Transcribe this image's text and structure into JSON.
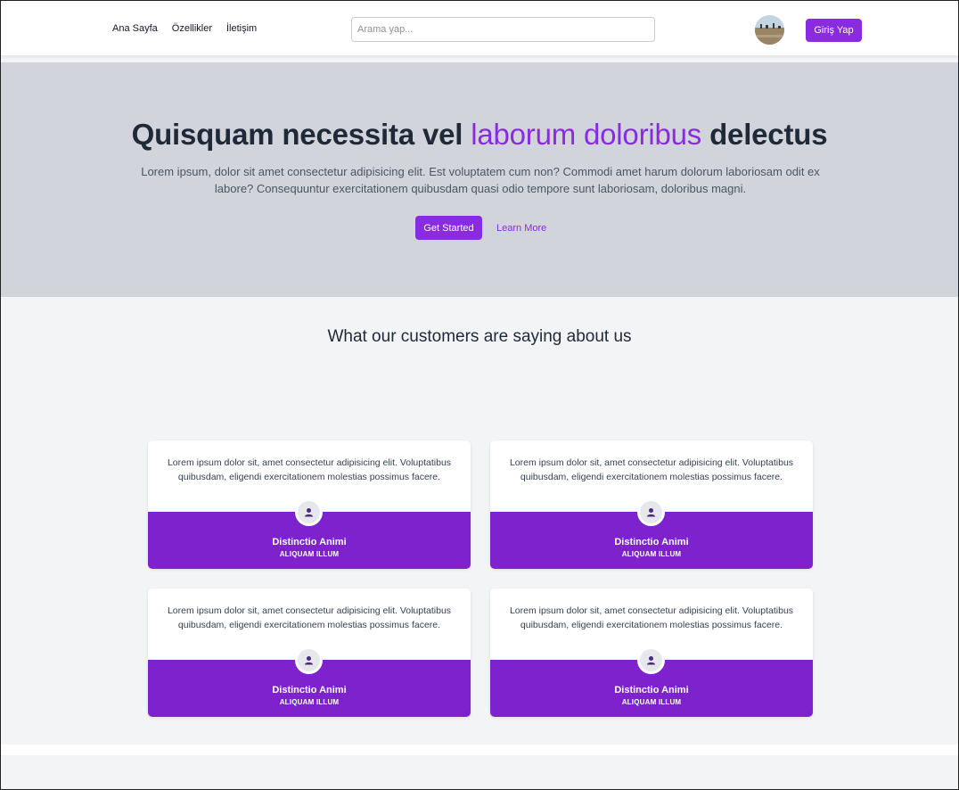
{
  "nav": {
    "links": [
      "Ana Sayfa",
      "Özellikler",
      "İletişim"
    ],
    "search_placeholder": "Arama yap...",
    "login_label": "Giriş Yap"
  },
  "hero": {
    "title_start": "Quisquam necessita vel ",
    "title_accent": "laborum doloribus",
    "title_end": " delectus",
    "subtitle": "Lorem ipsum, dolor sit amet consectetur adipisicing elit. Est voluptatem cum non? Commodi amet harum dolorum laboriosam odit ex labore? Consequuntur exercitationem quibusdam quasi odio tempore sunt laboriosam, doloribus magni.",
    "primary_cta": "Get Started",
    "secondary_cta": "Learn More"
  },
  "testimonials": {
    "title": "What our customers are saying about us",
    "items": [
      {
        "quote": "Lorem ipsum dolor sit, amet consectetur adipisicing elit. Voluptatibus quibusdam, eligendi exercitationem molestias possimus facere.",
        "name": "Distinctio Animi",
        "role": "ALIQUAM ILLUM"
      },
      {
        "quote": "Lorem ipsum dolor sit, amet consectetur adipisicing elit. Voluptatibus quibusdam, eligendi exercitationem molestias possimus facere.",
        "name": "Distinctio Animi",
        "role": "ALIQUAM ILLUM"
      },
      {
        "quote": "Lorem ipsum dolor sit, amet consectetur adipisicing elit. Voluptatibus quibusdam, eligendi exercitationem molestias possimus facere.",
        "name": "Distinctio Animi",
        "role": "ALIQUAM ILLUM"
      },
      {
        "quote": "Lorem ipsum dolor sit, amet consectetur adipisicing elit. Voluptatibus quibusdam, eligendi exercitationem molestias possimus facere.",
        "name": "Distinctio Animi",
        "role": "ALIQUAM ILLUM"
      }
    ]
  },
  "colors": {
    "accent": "#8a2be2",
    "card_footer": "#7e22ce",
    "hero_bg": "#d1d5db"
  }
}
